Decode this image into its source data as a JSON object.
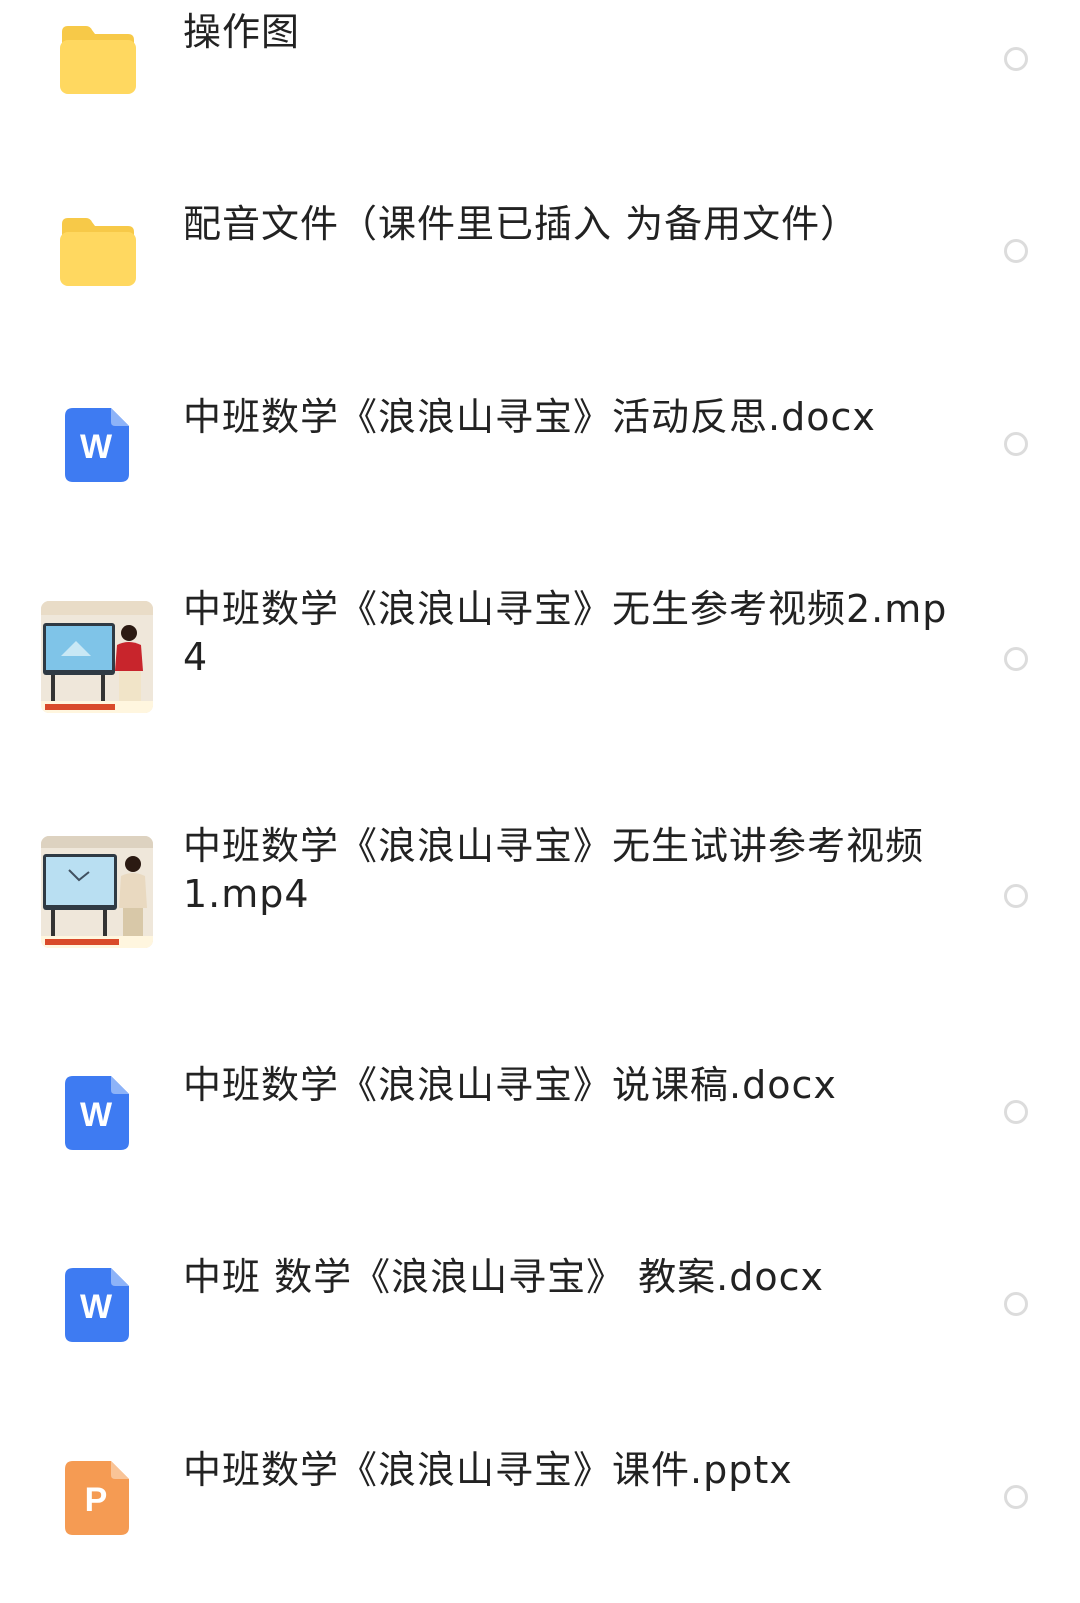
{
  "colors": {
    "folder": "#FFD860",
    "folder_tab": "#F7C948",
    "word": "#3E7BF2",
    "ppt": "#F59B53",
    "radio_border": "#DCDCDC",
    "text": "#222222"
  },
  "files": [
    {
      "type": "folder",
      "icon": "folder-icon",
      "name": "操作图"
    },
    {
      "type": "folder",
      "icon": "folder-icon",
      "name": "配音文件（课件里已插入 为备用文件）"
    },
    {
      "type": "docx",
      "icon": "word-icon",
      "icon_letter": "W",
      "name": "中班数学《浪浪山寻宝》活动反思.docx"
    },
    {
      "type": "mp4",
      "icon": "video-thumbnail",
      "name": "中班数学《浪浪山寻宝》无生参考视频2.mp4"
    },
    {
      "type": "mp4",
      "icon": "video-thumbnail",
      "name": "中班数学《浪浪山寻宝》无生试讲参考视频1.mp4"
    },
    {
      "type": "docx",
      "icon": "word-icon",
      "icon_letter": "W",
      "name": "中班数学《浪浪山寻宝》说课稿.docx"
    },
    {
      "type": "docx",
      "icon": "word-icon",
      "icon_letter": "W",
      "name": "中班 数学《浪浪山寻宝》 教案.docx"
    },
    {
      "type": "pptx",
      "icon": "ppt-icon",
      "icon_letter": "P",
      "name": "中班数学《浪浪山寻宝》课件.pptx"
    }
  ]
}
